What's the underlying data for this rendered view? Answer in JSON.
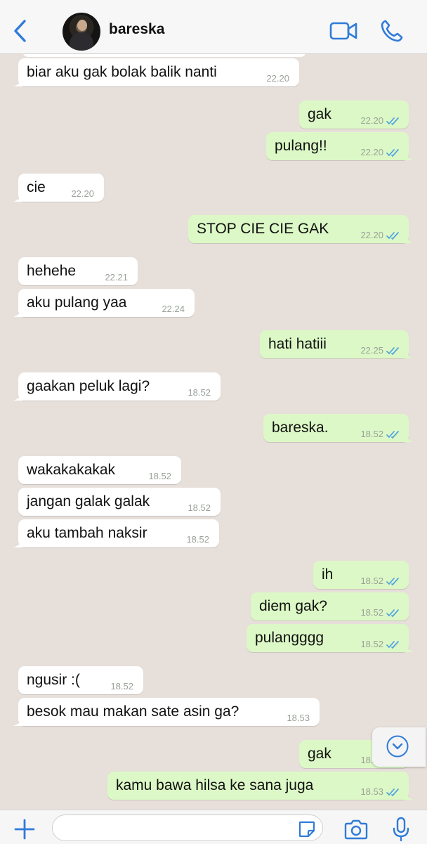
{
  "header": {
    "contact_name": "bareska",
    "back_icon": "chevron-left-icon",
    "video_icon": "video-camera-icon",
    "call_icon": "phone-icon"
  },
  "colors": {
    "background": "#e7dfda",
    "incoming_bubble": "#ffffff",
    "outgoing_bubble": "#dcf8c6",
    "accent": "#2f7bd9",
    "read_ticks": "#4fa3e0"
  },
  "messages": [
    {
      "dir": "in",
      "text": "biar aku gak bolak balik nanti",
      "time": "22.20"
    },
    {
      "dir": "out",
      "text": "gak",
      "time": "22.20"
    },
    {
      "dir": "out",
      "text": "pulang!!",
      "time": "22.20"
    },
    {
      "dir": "in",
      "text": "cie",
      "time": "22.20"
    },
    {
      "dir": "out",
      "text": "STOP CIE CIE GAK",
      "time": "22.20"
    },
    {
      "dir": "in",
      "text": "hehehe",
      "time": "22.21"
    },
    {
      "dir": "in",
      "text": "aku pulang yaa",
      "time": "22.24"
    },
    {
      "dir": "out",
      "text": "hati hatiii",
      "time": "22.25"
    },
    {
      "dir": "in",
      "text": "gaakan peluk lagi?",
      "time": "18.52"
    },
    {
      "dir": "out",
      "text": "bareska.",
      "time": "18.52"
    },
    {
      "dir": "in",
      "text": "wakakakakak",
      "time": "18.52"
    },
    {
      "dir": "in",
      "text": "jangan galak galak",
      "time": "18.52"
    },
    {
      "dir": "in",
      "text": "aku tambah naksir",
      "time": "18.52"
    },
    {
      "dir": "out",
      "text": "ih",
      "time": "18.52"
    },
    {
      "dir": "out",
      "text": "diem gak?",
      "time": "18.52"
    },
    {
      "dir": "out",
      "text": "pulangggg",
      "time": "18.52"
    },
    {
      "dir": "in",
      "text": "ngusir :(",
      "time": "18.52"
    },
    {
      "dir": "in",
      "text": "besok mau makan sate asin ga?",
      "time": "18.53"
    },
    {
      "dir": "out",
      "text": "gak",
      "time": "18.53"
    },
    {
      "dir": "out",
      "text": "kamu bawa hilsa ke sana juga",
      "time": "18.53"
    }
  ],
  "input_bar": {
    "plus_icon": "plus-icon",
    "message_placeholder": "",
    "sticker_icon": "sticker-icon",
    "camera_icon": "camera-icon",
    "mic_icon": "microphone-icon"
  },
  "scroll_button_icon": "chevron-down-circle-icon"
}
